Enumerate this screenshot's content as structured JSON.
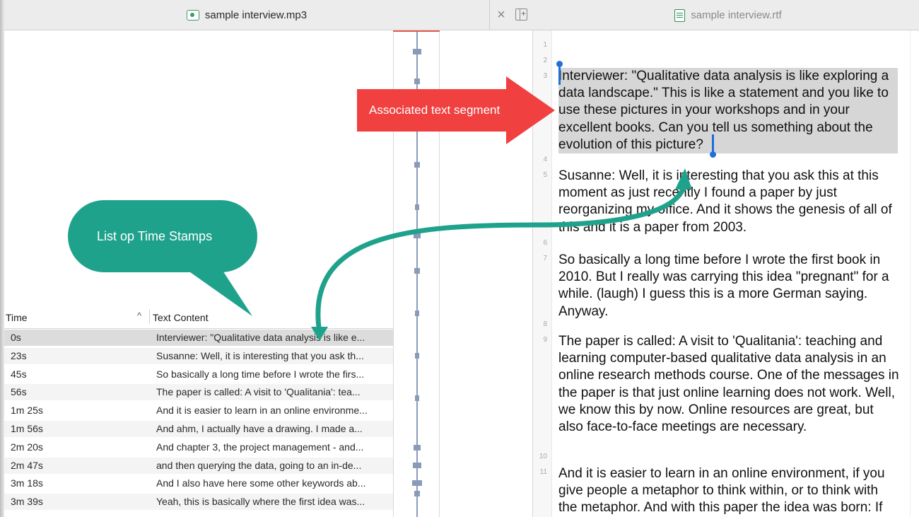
{
  "tabs": {
    "media": {
      "title": "sample interview.mp3",
      "icon": "audio-file-icon"
    },
    "document": {
      "title": "sample interview.rtf",
      "icon": "text-document-icon"
    },
    "close_icon": "close-icon",
    "split_icon": "split-view-icon"
  },
  "table": {
    "columns": {
      "time": "Time",
      "text": "Text Content",
      "sort_indicator": "^"
    },
    "rows": [
      {
        "time": "0s",
        "text": "Interviewer: \"Qualitative data analysis is like e..."
      },
      {
        "time": "23s",
        "text": "Susanne: Well, it is interesting that you ask th..."
      },
      {
        "time": "45s",
        "text": "So basically a long time before I wrote the firs..."
      },
      {
        "time": "56s",
        "text": "The paper is called: A visit to 'Qualitania': tea..."
      },
      {
        "time": "1m 25s",
        "text": "And it is easier to learn in an online environme..."
      },
      {
        "time": "1m 56s",
        "text": "And ahm, I actually have a drawing. I made a..."
      },
      {
        "time": "2m 20s",
        "text": "And chapter 3, the project management - and..."
      },
      {
        "time": "2m 47s",
        "text": "and then querying the data, going to an in-de..."
      },
      {
        "time": "3m 18s",
        "text": "And I also have here some other keywords ab..."
      },
      {
        "time": "3m 39s",
        "text": "Yeah, this is basically where the first idea was..."
      }
    ]
  },
  "document": {
    "line_numbers": [
      "1",
      "2",
      "3",
      "4",
      "5",
      "6",
      "7",
      "8",
      "9",
      "10",
      "11"
    ],
    "paragraphs": [
      "Interviewer: \"Qualitative data analysis is like exploring a data landscape.\" This is like a statement and you like to use these pictures in your workshops and in your excellent books. Can you tell us something about the evolution of this picture?",
      "Susanne: Well, it is interesting that you ask this at this moment as just recently I found a paper by just reorganizing my office. And it shows the genesis of all of this and it is a paper from 2003.",
      "So basically a long time before I wrote the first book in 2010. But I really was carrying this idea \"pregnant\" for a while. (laugh) I guess this is a more German saying. Anyway.",
      "The paper is called: A visit to 'Qualitania': teaching and learning computer-based qualitative data analysis in an online research methods course. One of the messages in the paper is that just online learning does not work. Well, we know this by now. Online resources are great, but also face-to-face meetings are necessary.",
      "And it is easier to learn in an online environment, if you give people a metaphor to think within, or to think with the metaphor. And with this paper the idea was born: If"
    ]
  },
  "annotations": {
    "red_arrow_label": "Associated text segment",
    "bubble_label": "List op Time Stamps",
    "red_color": "#f04040",
    "teal_color": "#1fa28c"
  },
  "colors": {
    "highlight": "#d6d6d6",
    "caret": "#1f6fd6",
    "playhead": "#e85a4f"
  }
}
